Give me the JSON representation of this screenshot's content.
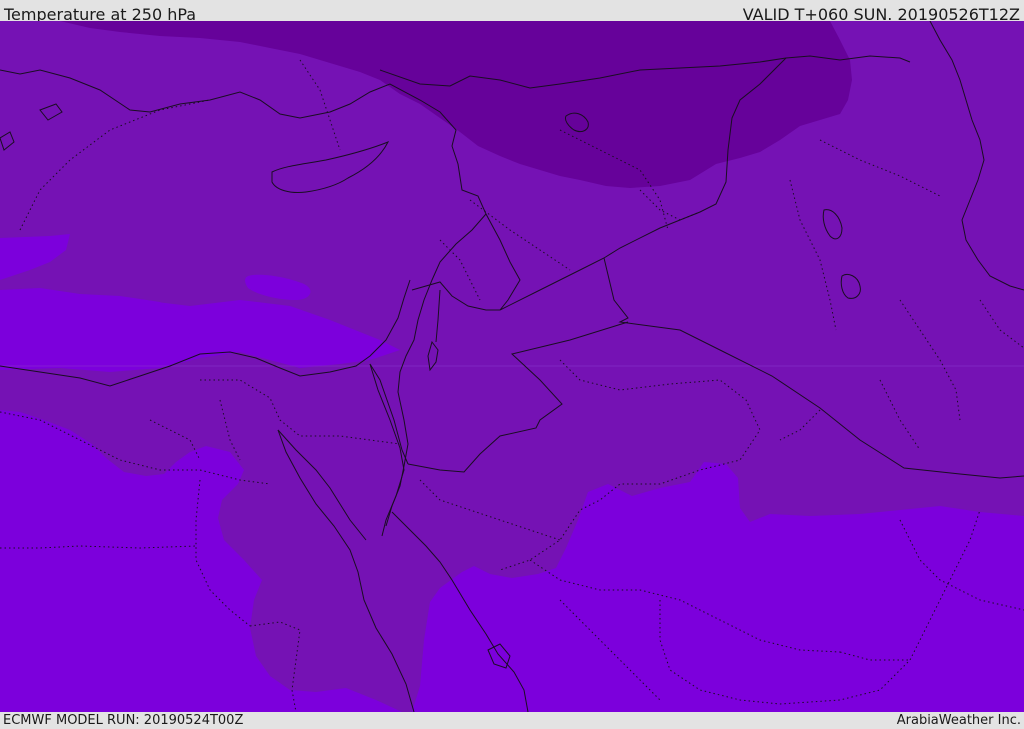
{
  "header": {
    "title": "Temperature at 250 hPa",
    "valid": "VALID T+060 SUN. 20190526T12Z"
  },
  "footer": {
    "model_run": "ECMWF MODEL RUN: 20190524T00Z",
    "credit": "ArabiaWeather Inc."
  },
  "colors": {
    "band_warmest": "#7c00dc",
    "band_middle": "#7512b4",
    "band_coldest": "#66029a",
    "boundaries": "#1a0d22"
  }
}
